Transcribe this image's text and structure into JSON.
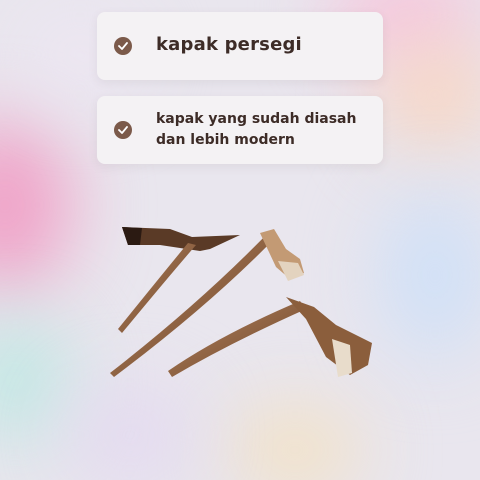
{
  "items": [
    {
      "text": "kapak persegi",
      "icon": "check-circle-icon"
    },
    {
      "text": "kapak yang sudah diasah dan lebih modern",
      "icon": "check-circle-icon"
    }
  ],
  "image": {
    "subject": "wooden-stone-axes"
  },
  "colors": {
    "check_bg": "#7b5a4a",
    "text": "#3d2c27",
    "card_bg": "#f4f2f4"
  }
}
